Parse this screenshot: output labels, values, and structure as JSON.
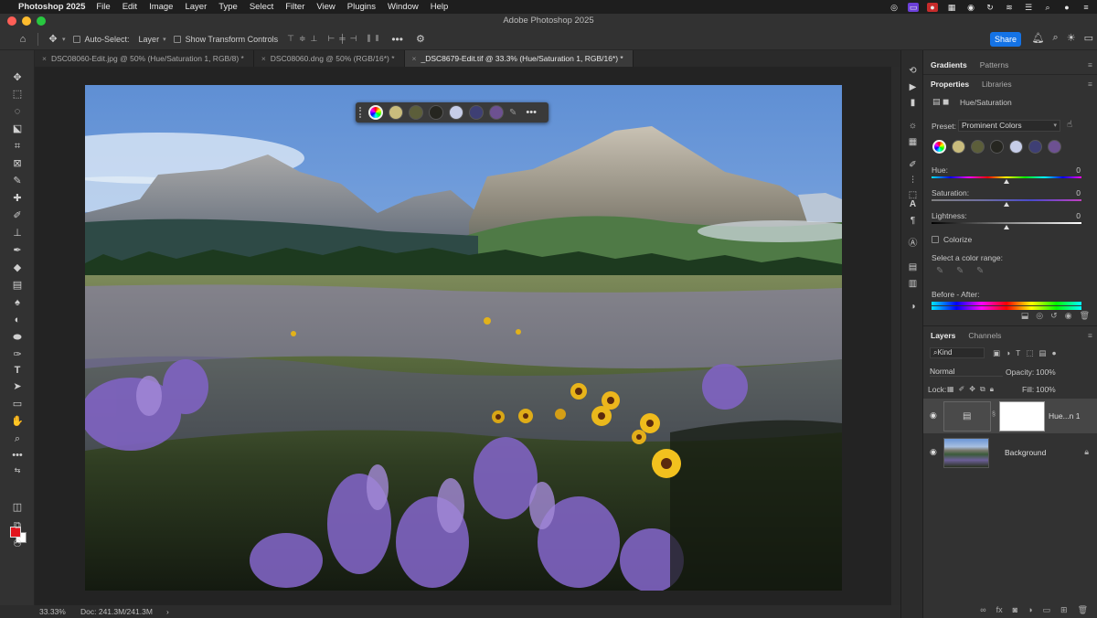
{
  "menubar": {
    "app": "Photoshop 2025",
    "items": [
      "File",
      "Edit",
      "Image",
      "Layer",
      "Type",
      "Select",
      "Filter",
      "View",
      "Plugins",
      "Window",
      "Help"
    ]
  },
  "window_title": "Adobe Photoshop 2025",
  "options": {
    "auto_select_label": "Auto-Select:",
    "auto_select_value": "Layer",
    "transform_label": "Show Transform Controls",
    "share_label": "Share"
  },
  "tabs": [
    {
      "label": "DSC08060-Edit.jpg @ 50% (Hue/Saturation 1, RGB/8) *"
    },
    {
      "label": "DSC08060.dng @ 50% (RGB/16*) *"
    },
    {
      "label": "_DSC8679-Edit.tif @ 33.3% (Hue/Saturation 1, RGB/16*) *"
    }
  ],
  "colors": {
    "swatches": [
      "#c9bc7d",
      "#5c5e3a",
      "#262620",
      "#c6cde8",
      "#3e3f74",
      "#6d5191"
    ],
    "accent": "#1473e6",
    "foreground": "#e2151e",
    "background": "#ffffff"
  },
  "panels": {
    "top_tabs": [
      "Gradients",
      "Patterns"
    ],
    "mid_tabs": [
      "Properties",
      "Libraries"
    ],
    "adjustment_title": "Hue/Saturation",
    "preset_label": "Preset:",
    "preset_value": "Prominent Colors",
    "hue_label": "Hue:",
    "hue_value": "0",
    "saturation_label": "Saturation:",
    "saturation_value": "0",
    "lightness_label": "Lightness:",
    "lightness_value": "0",
    "colorize_label": "Colorize",
    "color_range_label": "Select a color range:",
    "before_after_label": "Before - After:",
    "layer_tabs": [
      "Layers",
      "Channels"
    ],
    "kind_label": "Kind",
    "blend_mode": "Normal",
    "opacity_label": "Opacity:",
    "opacity_value": "100%",
    "lock_label": "Lock:",
    "fill_label": "Fill:",
    "fill_value": "100%",
    "layers": [
      {
        "name": "Hue...n 1"
      },
      {
        "name": "Background"
      }
    ]
  },
  "status": {
    "zoom": "33.33%",
    "doc": "Doc: 241.3M/241.3M"
  }
}
